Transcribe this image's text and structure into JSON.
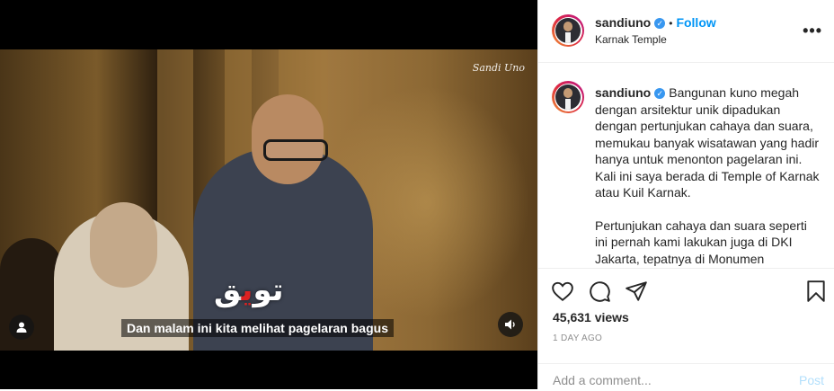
{
  "video": {
    "watermark": "Sandi Uno",
    "overlay_text_white_1": "ق",
    "overlay_text_red": "ي",
    "overlay_text_white_2": "تو",
    "subtitle": "Dan malam ini kita melihat pagelaran bagus"
  },
  "header": {
    "username": "sandiuno",
    "separator": "•",
    "follow_label": "Follow",
    "location": "Karnak Temple",
    "more_label": "•••"
  },
  "caption": {
    "username": "sandiuno",
    "paragraph1": "Bangunan kuno megah dengan arsitektur unik dipadukan dengan pertunjukan cahaya dan suara, memukau banyak wisatawan yang hadir hanya untuk menonton pagelaran ini. Kali ini saya berada di Temple of Karnak atau Kuil Karnak.",
    "paragraph2": "Pertunjukan cahaya dan suara seperti ini pernah kami lakukan juga di DKI Jakarta, tepatnya di Monumen"
  },
  "stats": {
    "views": "45,631 views",
    "time": "1 DAY AGO"
  },
  "comment": {
    "placeholder": "Add a comment...",
    "post_label": "Post"
  },
  "colors": {
    "accent": "#0095f6",
    "post_disabled": "#b2dffc",
    "verified": "#3897f0"
  }
}
